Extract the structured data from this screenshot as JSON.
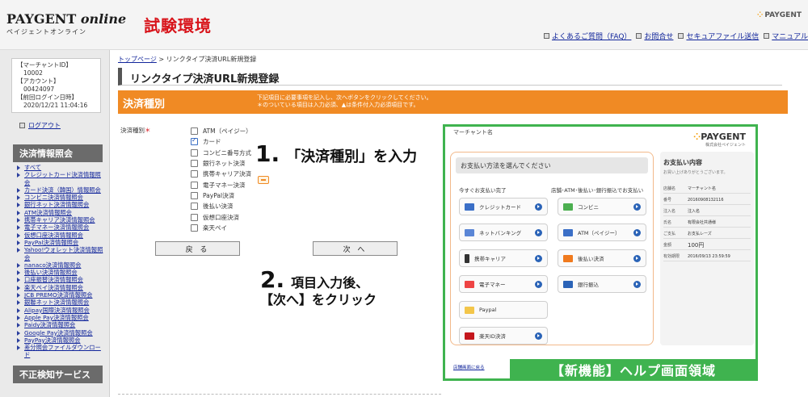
{
  "header": {
    "logo_main": "PAYGENT",
    "logo_italic": "online",
    "logo_sub": "ペイジェントオンライン",
    "env_title": "試験環境",
    "brand": "PAYGENT",
    "brand_dots": "⁘",
    "links": [
      {
        "label": "よくあるご質問（FAQ）"
      },
      {
        "label": "お問合せ"
      },
      {
        "label": "セキュアファイル送信"
      },
      {
        "label": "マニュアル"
      }
    ]
  },
  "sidebar": {
    "merchant": {
      "id_label": "【マーチャントID】",
      "id_value": "10002",
      "account_label": "【アカウント】",
      "account_value": "00424097",
      "last_login_label": "【前回ログイン日時】",
      "last_login_value": "2020/12/21 11:04:16"
    },
    "logout": "ログアウト",
    "section1_title": "決済情報照会",
    "section1_items": [
      "すべて",
      "クレジットカード決済情報照会",
      "カード決済（韓国）情報照会",
      "コンビニ決済情報照会",
      "銀行ネット決済情報照会",
      "ATM決済情報照会",
      "携帯キャリア決済情報照会",
      "電子マネー決済情報照会",
      "仮想口座決済情報照会",
      "PayPal決済情報照会",
      "Yahoo!ウォレット決済情報照会",
      "nanaco決済情報照会",
      "後払い決済情報照会",
      "口座振替決済情報照会",
      "楽天ペイ決済情報照会",
      "JCB PREMO決済情報照会",
      "銀聯ネット決済情報照会",
      "Alipay国際決済情報照会",
      "Apple Pay決済情報照会",
      "Paidy決済情報照会",
      "Google Pay決済情報照会",
      "PayPay決済情報照会",
      "差分照会ファイルダウンロード"
    ],
    "section2_title": "不正検知サービス"
  },
  "main": {
    "breadcrumb_top": "トップページ",
    "breadcrumb_sep": ">",
    "breadcrumb_current": "リンクタイプ決済URL新規登録",
    "page_title": "リンクタイプ決済URL新規登録",
    "section_label": "決済種別",
    "note_line1": "下記項目に必要事項を記入し、次へボタンをクリックしてください。",
    "note_line2": "＊のついている項目は入力必須、▲は条件付入力必須項目です。",
    "field_label": "決済種別",
    "required_mark": "＊",
    "options": [
      {
        "label": "ATM（ペイジー）",
        "checked": false
      },
      {
        "label": "カード",
        "checked": true
      },
      {
        "label": "コンビニ番号方式",
        "checked": false
      },
      {
        "label": "銀行ネット決済",
        "checked": false
      },
      {
        "label": "携帯キャリア決済",
        "checked": false
      },
      {
        "label": "電子マネー決済",
        "checked": false
      },
      {
        "label": "PayPal決済",
        "checked": false
      },
      {
        "label": "後払い決済",
        "checked": false
      },
      {
        "label": "仮想口座決済",
        "checked": false
      },
      {
        "label": "楽天ペイ",
        "checked": false
      }
    ],
    "back_label": "戻 る",
    "next_label": "次 へ",
    "step1_num": "1.",
    "step1_text": "「決済種別」を入力",
    "step2_num": "2.",
    "step2_text_line1": "項目入力後、",
    "step2_text_line2": "【次へ】をクリック"
  },
  "help": {
    "merchant_name": "マーチャント名",
    "brand": "PAYGENT",
    "brand_dots": "⁘",
    "brand_sub": "株式会社ペイジェント",
    "choice_head": "お支払い方法を選んでください",
    "col1_title": "今すぐお支払い完了",
    "col2_title": "店舗･ATM･後払い･銀行振込でお支払い",
    "col1_buttons": [
      "クレジットカード",
      "ネットバンキング",
      "携帯キャリア",
      "電子マネー",
      "Paypal",
      "楽天ID決済"
    ],
    "col2_buttons": [
      "コンビニ",
      "ATM（ペイジー）",
      "後払い決済",
      "銀行振込"
    ],
    "detail_title": "お支払い内容",
    "detail_sub": "お買い上げありがとうございます。",
    "detail_rows": [
      {
        "k": "店舗名",
        "v": "マーチャント名"
      },
      {
        "k": "番号",
        "v": "20160908132116"
      },
      {
        "k": "注入名",
        "v": "注入名"
      },
      {
        "k": "氏名",
        "v": "有限会社共通様"
      },
      {
        "k": "ご支払",
        "v": "お支払レーズ"
      },
      {
        "k": "金額",
        "v": "100円"
      },
      {
        "k": "有効期限",
        "v": "2016/09/13 23:59:59"
      }
    ],
    "footer_link": "店舗画面に戻る",
    "badge": "【新機能】ヘルプ画面領域"
  },
  "colors": {
    "env_title": "#d8141b",
    "orange": "#f08a24",
    "green": "#3fb34f",
    "link": "#12269b"
  }
}
